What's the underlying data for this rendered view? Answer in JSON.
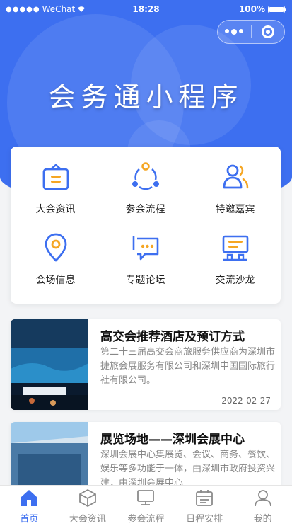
{
  "status_bar": {
    "carrier": "WeChat",
    "time": "18:28",
    "battery": "100%",
    "battery_level": 1.0
  },
  "app_title": "会务通小程序",
  "grid": [
    {
      "label": "大会资讯",
      "icon": "notice-board-icon"
    },
    {
      "label": "参会流程",
      "icon": "process-cycle-icon"
    },
    {
      "label": "特邀嘉宾",
      "icon": "guests-icon"
    },
    {
      "label": "会场信息",
      "icon": "location-pin-icon"
    },
    {
      "label": "专题论坛",
      "icon": "chat-bubble-icon"
    },
    {
      "label": "交流沙龙",
      "icon": "salon-icon"
    }
  ],
  "news": [
    {
      "title": "高交会推荐酒店及预订方式",
      "desc": "第二十三届高交会商旅服务供应商为深圳市捷旅会展服务有限公司和深圳中国国际旅行社有限公司。",
      "date": "2022-02-27"
    },
    {
      "title": "展览场地——深圳会展中心",
      "desc": "深圳会展中心集展览、会议、商务、餐饮、娱乐等多功能于一体，由深圳市政府投资兴建，由深圳会展中心"
    }
  ],
  "tabs": [
    {
      "label": "首页",
      "icon": "home-icon",
      "active": true
    },
    {
      "label": "大会资讯",
      "icon": "cube-icon",
      "active": false
    },
    {
      "label": "参会流程",
      "icon": "monitor-icon",
      "active": false
    },
    {
      "label": "日程安排",
      "icon": "calendar-icon",
      "active": false
    },
    {
      "label": "我的",
      "icon": "user-icon",
      "active": false
    }
  ],
  "colors": {
    "primary": "#3d6ff0",
    "accent_orange": "#f5a623"
  }
}
